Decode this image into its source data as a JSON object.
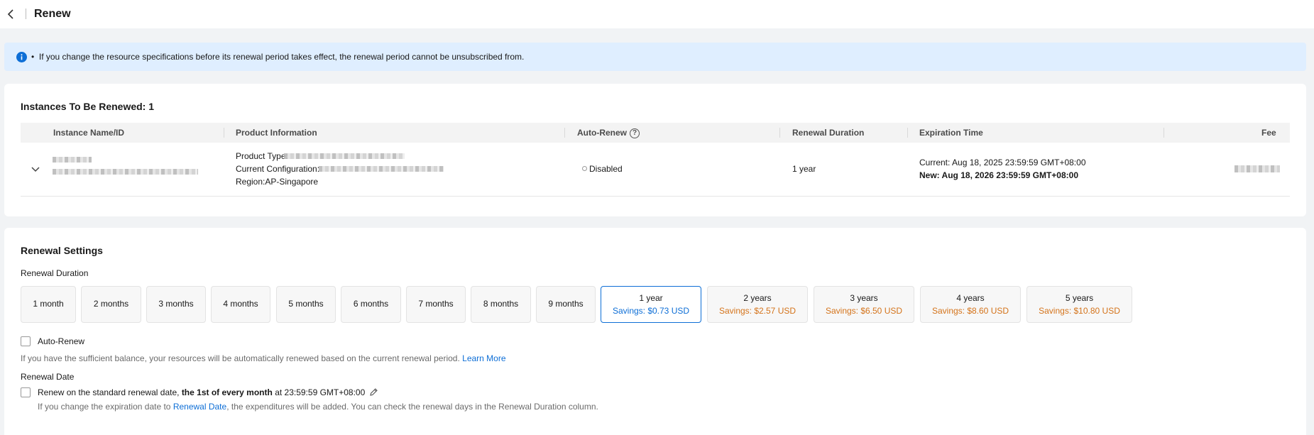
{
  "header": {
    "title": "Renew"
  },
  "notice": {
    "text": "If you change the resource specifications before its renewal period takes effect, the renewal period cannot be unsubscribed from."
  },
  "instances": {
    "title": "Instances To Be Renewed: 1",
    "columns": {
      "name": "Instance Name/ID",
      "product": "Product Information",
      "auto_renew": "Auto-Renew",
      "duration": "Renewal Duration",
      "expiration": "Expiration Time",
      "fee": "Fee"
    },
    "row": {
      "product_type_label": "Product Type:",
      "config_label": "Current Configuration:",
      "region": "Region:AP-Singapore",
      "auto_renew": "Disabled",
      "duration": "1 year",
      "current": "Current: Aug 18, 2025 23:59:59 GMT+08:00",
      "new": "New: Aug 18, 2026 23:59:59 GMT+08:00"
    }
  },
  "settings": {
    "title": "Renewal Settings",
    "duration_label": "Renewal Duration",
    "options": [
      {
        "label": "1 month",
        "savings": ""
      },
      {
        "label": "2 months",
        "savings": ""
      },
      {
        "label": "3 months",
        "savings": ""
      },
      {
        "label": "4 months",
        "savings": ""
      },
      {
        "label": "5 months",
        "savings": ""
      },
      {
        "label": "6 months",
        "savings": ""
      },
      {
        "label": "7 months",
        "savings": ""
      },
      {
        "label": "8 months",
        "savings": ""
      },
      {
        "label": "9 months",
        "savings": ""
      },
      {
        "label": "1 year",
        "savings": "Savings: $0.73 USD"
      },
      {
        "label": "2 years",
        "savings": "Savings: $2.57 USD"
      },
      {
        "label": "3 years",
        "savings": "Savings: $6.50 USD"
      },
      {
        "label": "4 years",
        "savings": "Savings: $8.60 USD"
      },
      {
        "label": "5 years",
        "savings": "Savings: $10.80 USD"
      }
    ],
    "selected_option": "1 year",
    "auto_renew_label": "Auto-Renew",
    "auto_renew_hint": "If you have the sufficient balance, your resources will be automatically renewed based on the current renewal period.",
    "learn_more": "Learn More",
    "renewal_date_label": "Renewal Date",
    "std_date_prefix": "Renew on the standard renewal date,",
    "std_date_bold": "the 1st of every month",
    "std_date_suffix": "at 23:59:59 GMT+08:00",
    "date_hint_prefix": "If you change the expiration date to",
    "date_hint_link": "Renewal Date",
    "date_hint_suffix": ", the expenditures will be added. You can check the renewal days in the Renewal Duration column."
  }
}
